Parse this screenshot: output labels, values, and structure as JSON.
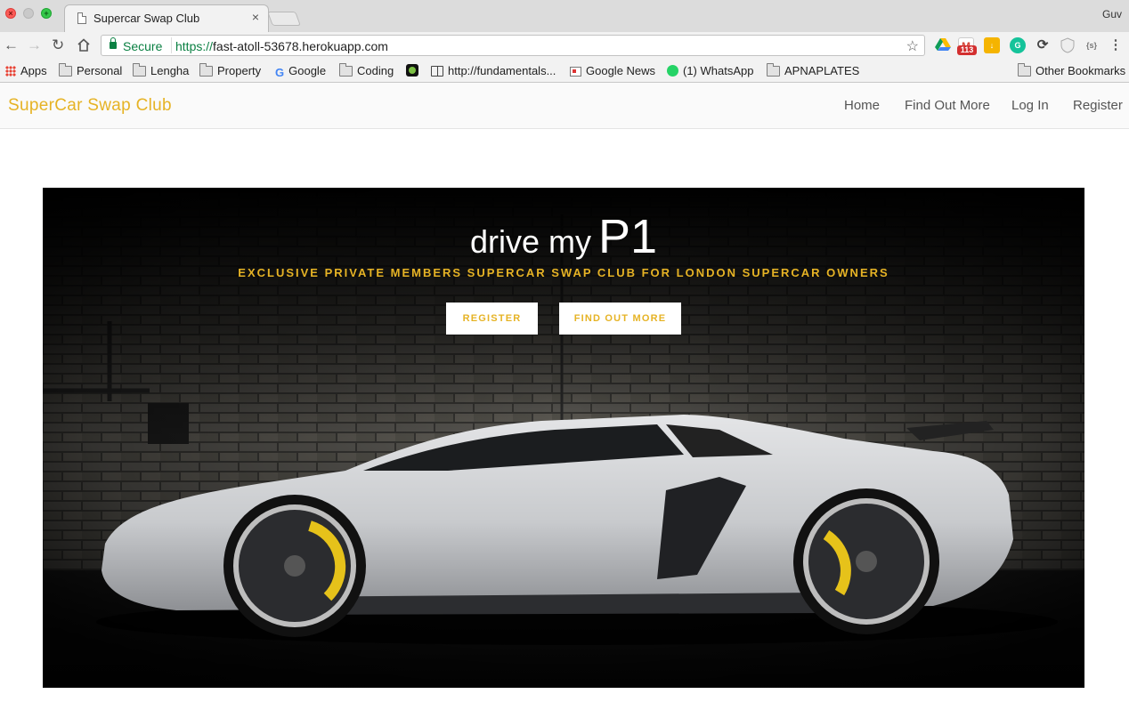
{
  "browser": {
    "tab_title": "Supercar Swap Club",
    "tab_close": "×",
    "profile_name": "Guv",
    "address": {
      "secure_label": "Secure",
      "scheme": "https://",
      "host": "fast-atoll-53678.herokuapp.com"
    },
    "extensions": {
      "gmail_badge": "113",
      "page_badge": "{s}"
    },
    "bookmarks": [
      {
        "label": "Apps",
        "icon": "apps-icon"
      },
      {
        "label": "Personal",
        "icon": "folder-icon"
      },
      {
        "label": "Lengha",
        "icon": "folder-icon"
      },
      {
        "label": "Property",
        "icon": "folder-icon"
      },
      {
        "label": "Google",
        "icon": "google-icon"
      },
      {
        "label": "Coding",
        "icon": "folder-icon"
      },
      {
        "label": "",
        "icon": "green-dot-icon"
      },
      {
        "label": "http://fundamentals...",
        "icon": "book-icon"
      },
      {
        "label": "Google News",
        "icon": "news-icon"
      },
      {
        "label": "(1) WhatsApp",
        "icon": "whatsapp-icon"
      },
      {
        "label": "APNAPLATES",
        "icon": "folder-icon"
      }
    ],
    "other_bookmarks": "Other Bookmarks"
  },
  "site": {
    "brand": "SuperCar Swap Club",
    "nav": [
      "Home",
      "Find Out More",
      "Log In",
      "Register"
    ],
    "hero": {
      "headline_small": "drive my",
      "headline_big": "P1",
      "tagline": "EXCLUSIVE PRIVATE MEMBERS SUPERCAR SWAP CLUB FOR LONDON SUPERCAR OWNERS",
      "register_button": "REGISTER",
      "more_button": "FIND OUT MORE"
    }
  },
  "colors": {
    "brand_gold": "#e6b325",
    "secure_green": "#0b8043"
  }
}
